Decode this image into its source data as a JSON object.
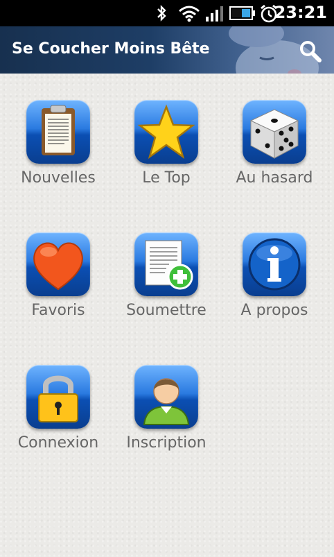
{
  "status": {
    "time": "23:21"
  },
  "app": {
    "title": "Se Coucher Moins Bête"
  },
  "menu": [
    {
      "label": "Nouvelles",
      "icon": "clipboard-icon"
    },
    {
      "label": "Le Top",
      "icon": "star-icon"
    },
    {
      "label": "Au hasard",
      "icon": "dice-icon"
    },
    {
      "label": "Favoris",
      "icon": "heart-icon"
    },
    {
      "label": "Soumettre",
      "icon": "document-add-icon"
    },
    {
      "label": "A propos",
      "icon": "info-icon"
    },
    {
      "label": "Connexion",
      "icon": "lock-icon"
    },
    {
      "label": "Inscription",
      "icon": "user-icon"
    }
  ],
  "colors": {
    "appbar": "#1e3e66",
    "icon_blue": "#2a7ae0",
    "label_gray": "#666666"
  }
}
